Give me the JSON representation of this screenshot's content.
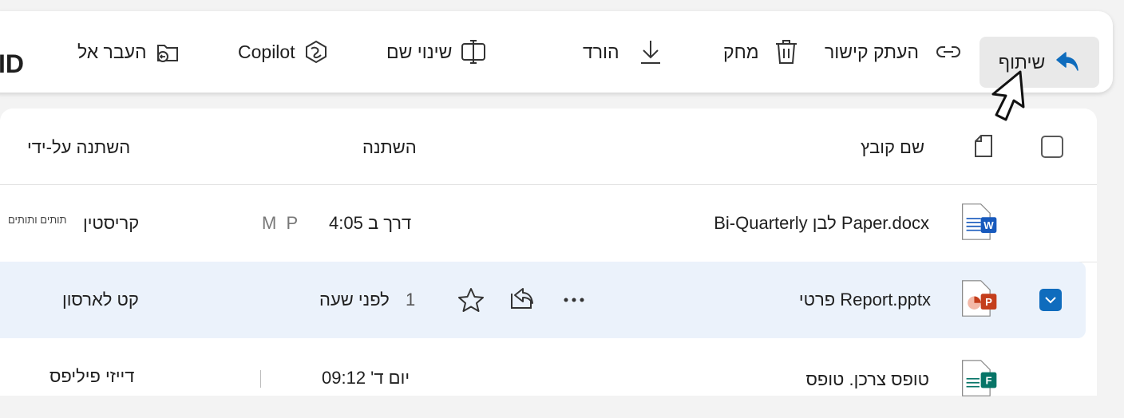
{
  "toolbar": {
    "share_label": "שיתוף",
    "copy_link_label": "העתק קישור",
    "delete_label": "מחק",
    "download_label": "הורד",
    "rename_label": "שינוי שם",
    "copilot_label": "Copilot",
    "move_label": "העבר אל",
    "id_text": "ID"
  },
  "table": {
    "headers": {
      "name": "שם קובץ",
      "modified": "השתנה",
      "modified_by": "השתנה על-ידי"
    },
    "rows": [
      {
        "name": "Bi-Quarterly לבן Paper.docx",
        "modified": "דרך ב 4:05",
        "modified_suffix": "M  P",
        "modified_by": "קריסטין",
        "modified_by_extra": "תותים ותותים",
        "icon": "word-file-icon",
        "selected": false
      },
      {
        "name": "פרטי Report.pptx",
        "modified": "לפני שעה",
        "modified_prefix": "1",
        "modified_by": "קט לארסון",
        "icon": "powerpoint-file-icon",
        "selected": true
      },
      {
        "name": "טופס צרכן. טופס",
        "modified": "יום ד' 09:12",
        "modified_by": "דייזי פיליפס",
        "icon": "forms-file-icon",
        "selected": false
      }
    ]
  },
  "colors": {
    "accent": "#0f6cbd",
    "selected_row": "#ebf2fb",
    "word": "#185abd",
    "powerpoint": "#c43e1c",
    "forms": "#077568"
  }
}
